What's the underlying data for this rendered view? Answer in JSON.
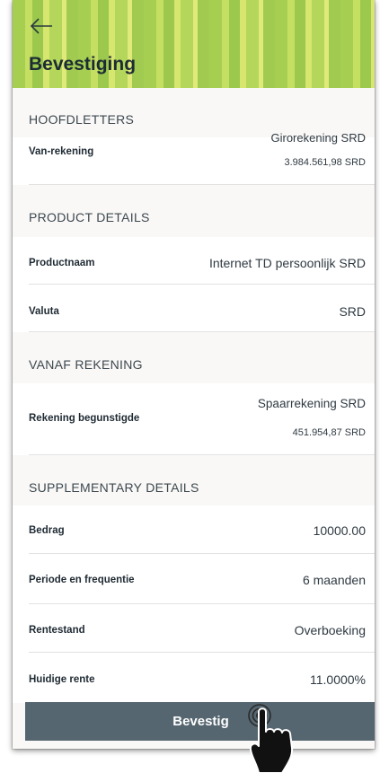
{
  "header": {
    "title": "Bevestiging",
    "back_icon": "arrow-left-icon"
  },
  "sections": {
    "main": {
      "heading": "HOOFDLETTERS",
      "from_account_label": "Van-rekening",
      "from_account_name": "Girorekening SRD",
      "from_account_balance": "3.984.561,98 SRD"
    },
    "product": {
      "heading": "PRODUCT DETAILS",
      "product_name_label": "Productnaam",
      "product_name_value": "Internet TD persoonlijk SRD",
      "currency_label": "Valuta",
      "currency_value": "SRD"
    },
    "from": {
      "heading": "VANAF REKENING",
      "beneficiary_label": "Rekening begunstigde",
      "beneficiary_name": "Spaarrekening SRD",
      "beneficiary_balance": "451.954,87 SRD"
    },
    "supplementary": {
      "heading": "SUPPLEMENTARY DETAILS",
      "amount_label": "Bedrag",
      "amount_value": "10000.00",
      "period_label": "Periode en frequentie",
      "period_value": "6 maanden",
      "rate_label": "Rentestand",
      "rate_value": "Overboeking",
      "current_rate_label": "Huidige rente",
      "current_rate_value": "11.0000%"
    }
  },
  "confirm_button": {
    "label": "Bevestig"
  },
  "colors": {
    "button_bg": "#556670",
    "header_green": "#a6cf52",
    "background": "#f9f8f6"
  }
}
